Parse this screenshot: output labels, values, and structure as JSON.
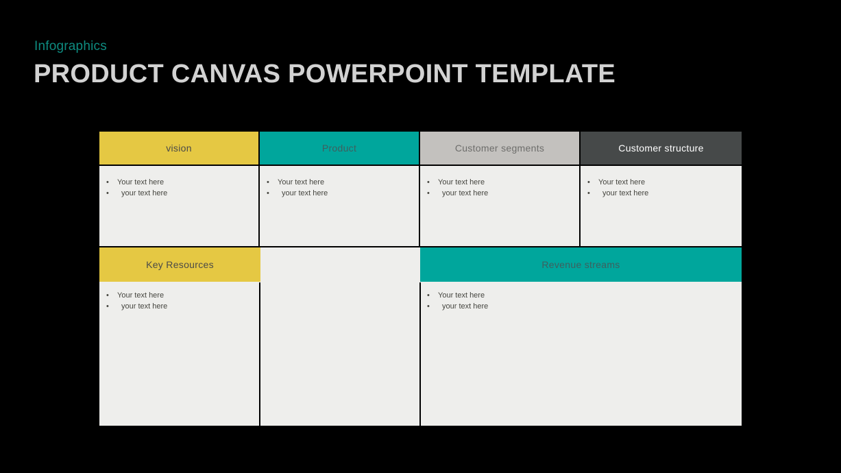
{
  "slide": {
    "eyebrow": "Infographics",
    "title": "PRODUCT CANVAS POWERPOINT TEMPLATE",
    "background_color": "#000000",
    "title_color": "#d2d2d2",
    "eyebrow_color": "#0e8b80"
  },
  "palette": {
    "yellow": "#e5c843",
    "teal": "#00a69c",
    "light_gray": "#c3c1be",
    "dark_gray": "#464949",
    "cell_background": "#eeeeec"
  },
  "canvas": {
    "top_row": [
      {
        "header": "vision",
        "header_style": "yellow",
        "bullets": [
          "Your text here",
          "your text here"
        ]
      },
      {
        "header": "Product",
        "header_style": "teal",
        "bullets": [
          "Your text here",
          "your text here"
        ]
      },
      {
        "header": "Customer segments",
        "header_style": "light_gray",
        "bullets": [
          "Your text here",
          "your text here"
        ]
      },
      {
        "header": "Customer structure",
        "header_style": "dark_gray",
        "bullets": [
          "Your text here",
          "your text here"
        ]
      }
    ],
    "bottom_row": [
      {
        "header": "Key Resources",
        "header_style": "yellow",
        "bullets": [
          "Your text here",
          "your text here"
        ]
      },
      {
        "header": "",
        "header_style": "blank",
        "bullets": []
      },
      {
        "header": "Revenue streams",
        "header_style": "teal",
        "bullets": [
          "Your text here",
          "your text here"
        ]
      }
    ]
  }
}
